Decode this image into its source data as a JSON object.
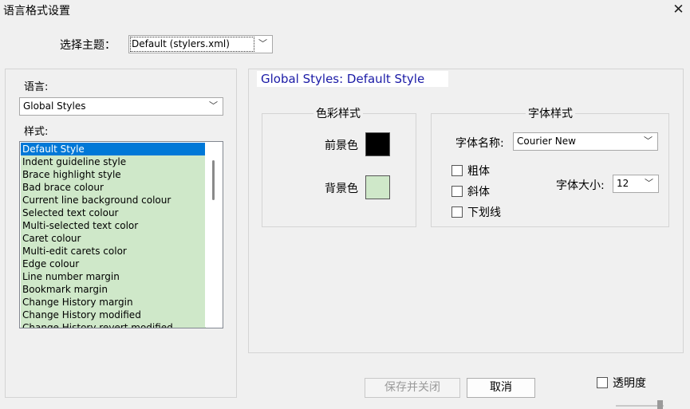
{
  "window": {
    "title": "语言格式设置",
    "close_glyph": "✕"
  },
  "theme": {
    "label": "选择主题：",
    "selected": "Default (stylers.xml)"
  },
  "language": {
    "label": "语言:",
    "selected": "Global Styles"
  },
  "styles": {
    "label": "样式:",
    "selected_index": 0,
    "items": [
      "Default Style",
      "Indent guideline style",
      "Brace highlight style",
      "Bad brace colour",
      "Current line background colour",
      "Selected text colour",
      "Multi-selected text color",
      "Caret colour",
      "Multi-edit carets color",
      "Edge colour",
      "Line number margin",
      "Bookmark margin",
      "Change History margin",
      "Change History modified",
      "Change History revert modified"
    ]
  },
  "style_panel": {
    "title": "Global Styles: Default Style"
  },
  "color_style": {
    "title": "色彩样式",
    "foreground_label": "前景色",
    "foreground_color": "#000000",
    "background_label": "背景色",
    "background_color": "#cfe8c9"
  },
  "font_style": {
    "title": "字体样式",
    "font_name_label": "字体名称:",
    "font_name": "Courier New",
    "bold_label": "粗体",
    "italic_label": "斜体",
    "underline_label": "下划线",
    "font_size_label": "字体大小:",
    "font_size": "12"
  },
  "buttons": {
    "save_close": "保存并关闭",
    "cancel": "取消"
  },
  "transparency": {
    "label": "透明度"
  },
  "colors": {
    "title_text": "#1a1aa6",
    "selection": "#0078d7",
    "list_bg": "#cfe8c9"
  }
}
